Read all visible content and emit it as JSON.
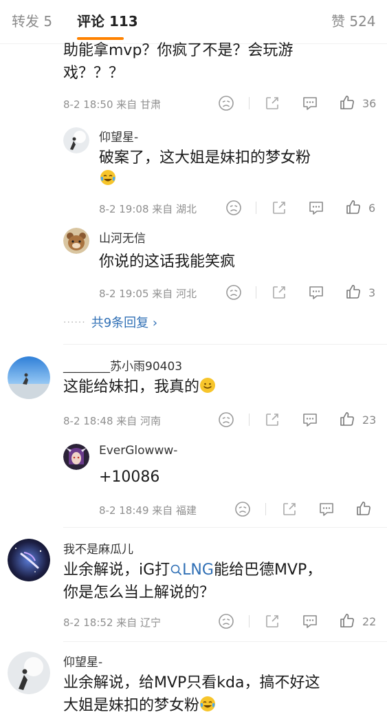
{
  "tabs": {
    "repost": "转发 5",
    "comments": "评论 113",
    "likes": "赞 524"
  },
  "comments": [
    {
      "text_line1": "助能拿mvp？你疯了不是？会玩游",
      "text_line2": "戏？？？",
      "meta": "8-2 18:50 来自 甘肃",
      "likes": "36"
    },
    {
      "name": "仰望星-",
      "text_line1": "破案了，这大姐是妹扣的梦女粉",
      "meta": "8-2 19:08 来自 湖北",
      "likes": "6"
    },
    {
      "name": "山河无信",
      "text_line1": "你说的这话我能笑疯",
      "meta": "8-2 19:05 来自 河北",
      "likes": "3"
    },
    {
      "name": "________苏小雨90403",
      "text_line1": "这能给妹扣，我真的",
      "meta": "8-2 18:48 来自 河南",
      "likes": "23"
    },
    {
      "name": "EverGlowww-",
      "text_line1": "+10086",
      "meta": "8-2 18:49 来自 福建",
      "likes": ""
    },
    {
      "name": "我不是麻瓜儿",
      "text_line1_pre": "业余解说，iG打",
      "text_line1_link": "LNG",
      "text_line1_post": "能给巴德MVP，",
      "text_line2": "你是怎么当上解说的？",
      "meta": "8-2 18:52 来自 辽宁",
      "likes": "22"
    },
    {
      "name": "仰望星-",
      "text_line1": "业余解说，给MVP只看kda，搞不好这",
      "text_line2": "大姐是妹扣的梦女粉"
    }
  ],
  "replies_more": "共9条回复 ›",
  "replies_dots": "······",
  "colors": {
    "accent": "#ff8200",
    "link": "#2f6fb5"
  }
}
